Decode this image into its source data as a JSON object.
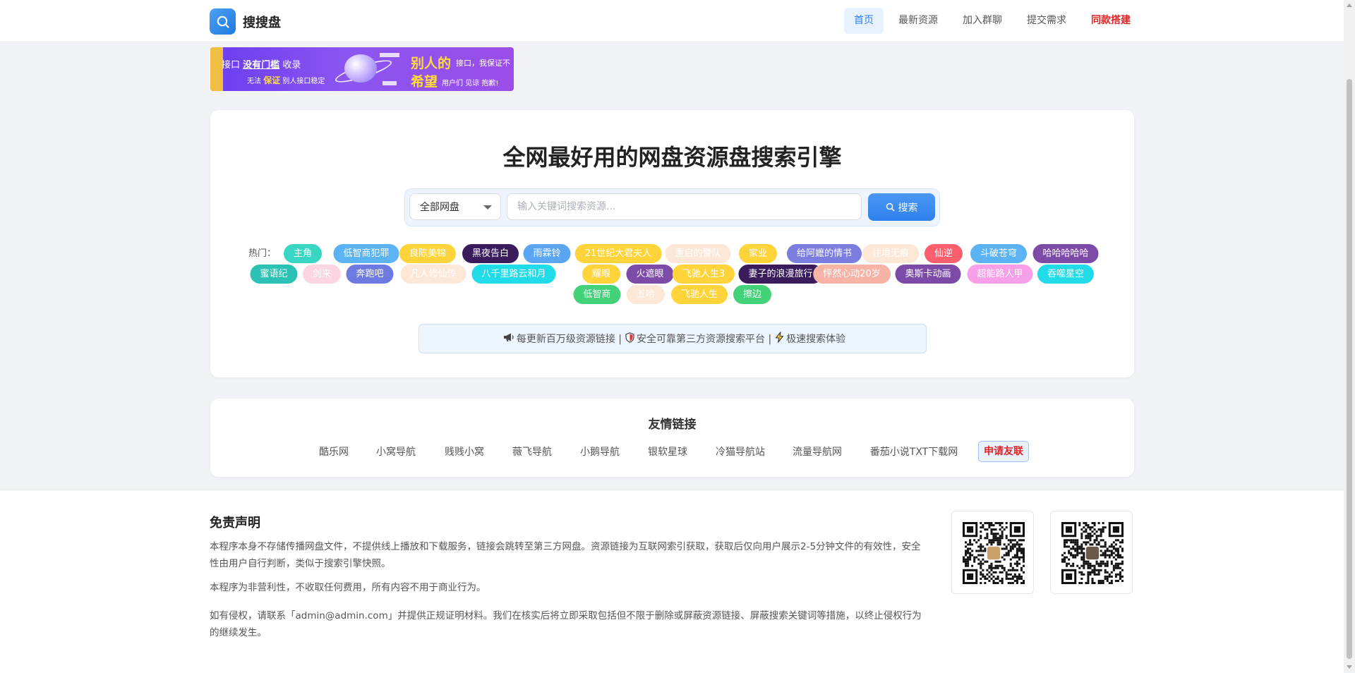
{
  "header": {
    "site_name": "搜搜盘",
    "nav": [
      "首页",
      "最新资源",
      "加入群聊",
      "提交需求",
      "同款搭建"
    ]
  },
  "banner": {
    "line1_a": "接口",
    "line1_b": "没有门槛",
    "line1_c": "收录",
    "line2_a": "无法",
    "line2_b": "保证",
    "line2_c": "别人接口稳定",
    "right1_big": "别人的",
    "right1_small": "接口，我保证不",
    "right2_big": "希望",
    "right2_small": "用户们 见谅 抱歉!"
  },
  "hero": {
    "title": "全网最好用的网盘资源盘搜索引擎",
    "select_value": "全部网盘",
    "search_placeholder": "输入关键词搜索资源...",
    "search_button": "搜索",
    "hot_label": "热门：",
    "hot_tags": [
      {
        "label": "主角",
        "color": "#3ad6c4"
      },
      {
        "label": "低智商犯罪",
        "color": "#5cb3f3"
      },
      {
        "label": "良陈美锦",
        "color": "#ffd43b"
      },
      {
        "label": "黑夜告白",
        "color": "#3a1c5c"
      },
      {
        "label": "雨霖铃",
        "color": "#5aa6f2"
      },
      {
        "label": "21世纪大君夫人",
        "color": "#ffd43b"
      },
      {
        "label": "重启的警队",
        "color": "#fde7d6"
      },
      {
        "label": "家业",
        "color": "#ffd43b"
      },
      {
        "label": "给阿嬷的情书",
        "color": "#7b7ddf"
      },
      {
        "label": "往境无痕",
        "color": "#fde7d6"
      },
      {
        "label": "仙逆",
        "color": "#ff5f6d"
      },
      {
        "label": "斗破苍穹",
        "color": "#5cb3f3"
      },
      {
        "label": "哈哈哈哈哈",
        "color": "#7c4ba8"
      },
      {
        "label": "蜜语纪",
        "color": "#2cc1b5"
      },
      {
        "label": "剑来",
        "color": "#fbd6e2"
      },
      {
        "label": "奔跑吧",
        "color": "#6e7ae0"
      },
      {
        "label": "凡人修仙传",
        "color": "#fde7d6"
      },
      {
        "label": "八千里路云和月",
        "color": "#21dbe9"
      },
      {
        "label": "耀眼",
        "color": "#ffd43b"
      },
      {
        "label": "火遮眼",
        "color": "#7c4ba8"
      },
      {
        "label": "飞驰人生3",
        "color": "#ffd43b"
      },
      {
        "label": "妻子的浪漫旅行",
        "color": "#3a1c5c"
      },
      {
        "label": "怦然心动20岁",
        "color": "#f6b3a6"
      },
      {
        "label": "奥斯卡动画",
        "color": "#7c4ba8"
      },
      {
        "label": "超能路人甲",
        "color": "#f7a0e8"
      },
      {
        "label": "吞噬星空",
        "color": "#21dbe9"
      },
      {
        "label": "低智商",
        "color": "#43d17a"
      },
      {
        "label": "五哈",
        "color": "#fde7d6"
      },
      {
        "label": "飞驰人生",
        "color": "#ffd43b"
      },
      {
        "label": "擦边",
        "color": "#43d17a"
      }
    ],
    "info_parts": [
      "每更新百万级资源链接 |",
      "安全可靠第三方资源搜索平台 |",
      "极速搜索体验"
    ]
  },
  "friend_links": {
    "title": "友情链接",
    "items": [
      "酷乐网",
      "小窝导航",
      "贱贱小窝",
      "薇飞导航",
      "小鹅导航",
      "银软星球",
      "冷猫导航站",
      "流量导航网",
      "番茄小说TXT下载网"
    ],
    "apply": "申请友联"
  },
  "footer": {
    "title": "免责声明",
    "p1": "本程序本身不存储传播网盘文件，不提供线上播放和下载服务，链接会跳转至第三方网盘。资源链接为互联网索引获取，获取后仅向用户展示2-5分钟文件的有效性，安全性由用户自行判断，类似于搜索引擎快照。",
    "p2": "本程序为非营利性，不收取任何费用，所有内容不用于商业行为。",
    "p3": "如有侵权，请联系「admin@admin.com」并提供正规证明材料。我们在核实后将立即采取包括但不限于删除或屏蔽资源链接、屏蔽搜索关键词等措施，以终止侵权行为的继续发生。"
  }
}
